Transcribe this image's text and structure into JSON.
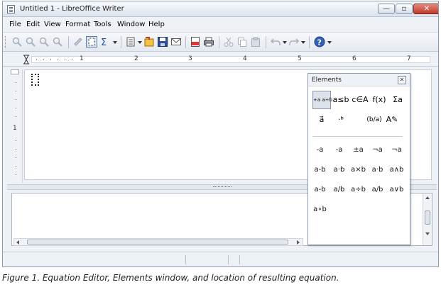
{
  "window": {
    "title": "Untitled 1 - LibreOffice Writer",
    "controls": {
      "minimize": "—",
      "maximize": "▫",
      "close": "✕"
    }
  },
  "menubar": {
    "items": [
      "File",
      "Edit",
      "View",
      "Format",
      "Tools",
      "Window",
      "Help"
    ]
  },
  "toolbar": {
    "icons": [
      "zoom-in-icon",
      "zoom-out-icon",
      "zoom-100-icon",
      "zoom-page-icon",
      "update-icon",
      "formula-cursor-icon",
      "symbols-icon",
      "open-icon",
      "new-icon",
      "save-icon",
      "email-icon",
      "export-pdf-icon",
      "print-icon",
      "cut-icon",
      "copy-icon",
      "paste-icon",
      "undo-icon",
      "redo-icon",
      "help-icon"
    ]
  },
  "ruler": {
    "numbers": [
      "1",
      "2",
      "3",
      "4",
      "5",
      "6",
      "7"
    ]
  },
  "vertical_ruler": {
    "numbers": [
      "1"
    ]
  },
  "elements_panel": {
    "title": "Elements",
    "close_label": "✕",
    "categories": [
      {
        "name": "unary-binary",
        "label": "+a a÷b",
        "selected": true
      },
      {
        "name": "relations",
        "label": "a≤b"
      },
      {
        "name": "set-operations",
        "label": "c∈A"
      },
      {
        "name": "functions",
        "label": "f(x)"
      },
      {
        "name": "operators",
        "label": "Σa"
      },
      {
        "name": "attributes",
        "label": "a⃗"
      },
      {
        "name": "brackets",
        "label": "·ᵇ"
      },
      {
        "name": "formats",
        "label": "(b/a)"
      },
      {
        "name": "others",
        "label": "A✎"
      }
    ],
    "symbols": [
      [
        "-a",
        "-a",
        "±a",
        "¬a",
        "¬a"
      ],
      [
        "a-b",
        "a·b",
        "a×b",
        "a·b",
        "a∧b"
      ],
      [
        "a-b",
        "a/b",
        "a÷b",
        "a/b",
        "a∨b"
      ],
      [
        "a∘b"
      ]
    ]
  },
  "caption": "Figure 1. Equation Editor, Elements window, and location of resulting equation."
}
